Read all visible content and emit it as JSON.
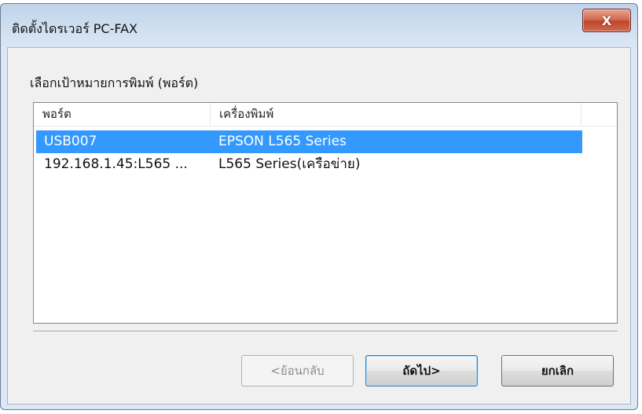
{
  "window": {
    "title": "ติดตั้งไดรเวอร์ PC-FAX",
    "close_label": "X"
  },
  "group_label": "เลือกเป้าหมายการพิมพ์ (พอร์ต)",
  "list": {
    "columns": [
      "พอร์ต",
      "เครื่องพิมพ์"
    ],
    "rows": [
      {
        "port": "USB007",
        "printer": "EPSON L565 Series",
        "selected": true
      },
      {
        "port": "192.168.1.45:L565 ...",
        "printer": "L565 Series(เครือข่าย)",
        "selected": false
      }
    ]
  },
  "buttons": {
    "back": "<ย้อนกลับ",
    "next": "ถัดไป>",
    "cancel": "ยกเลิก"
  },
  "colors": {
    "selection": "#3399ff",
    "close_button": "#c0452a"
  },
  "icons": {
    "close": "close-icon"
  }
}
